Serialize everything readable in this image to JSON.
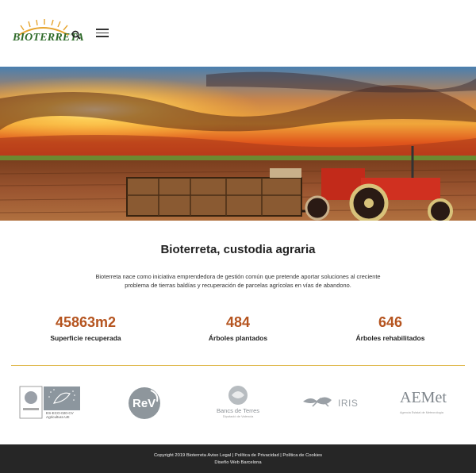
{
  "header": {
    "logo_text": "BIOTERRETA",
    "search_icon": "search-icon",
    "menu_icon": "hamburger-menu-icon"
  },
  "intro": {
    "title": "Bioterreta, custodia agraria",
    "text": "Bioterreta nace como iniciativa emprendedora de gestión común que pretende aportar soluciones al creciente problema de tierras baldías y recuperación de parcelas agrícolas en vías de abandono."
  },
  "stats": [
    {
      "value": "45863m2",
      "label": "Superficie recuperada"
    },
    {
      "value": "484",
      "label": "Árboles plantados"
    },
    {
      "value": "646",
      "label": "Árboles rehabilitados"
    }
  ],
  "partners": {
    "eu_organic": {
      "code": "ES-ECO-020-CV",
      "caption": "Agricultura UE"
    },
    "rev": {
      "text": "ReV"
    },
    "bancs": {
      "name": "Bancs de Terres",
      "sub": "Diputació de Valencia"
    },
    "iris": {
      "text": "IRIS"
    },
    "aemet": {
      "name": "AEMet",
      "sub": "Agencia Estatal de Meteorología"
    }
  },
  "footer": {
    "copyright": "Copyright 2019 Bioterreta",
    "links": [
      "Aviso Legal",
      "Política de Privacidad",
      "Política de Cookies"
    ],
    "separator": " | ",
    "credit": "Diseño Web Barcelona"
  },
  "colors": {
    "accent": "#b5541f",
    "divider": "#e0b94e",
    "footer_bg": "#262626"
  }
}
